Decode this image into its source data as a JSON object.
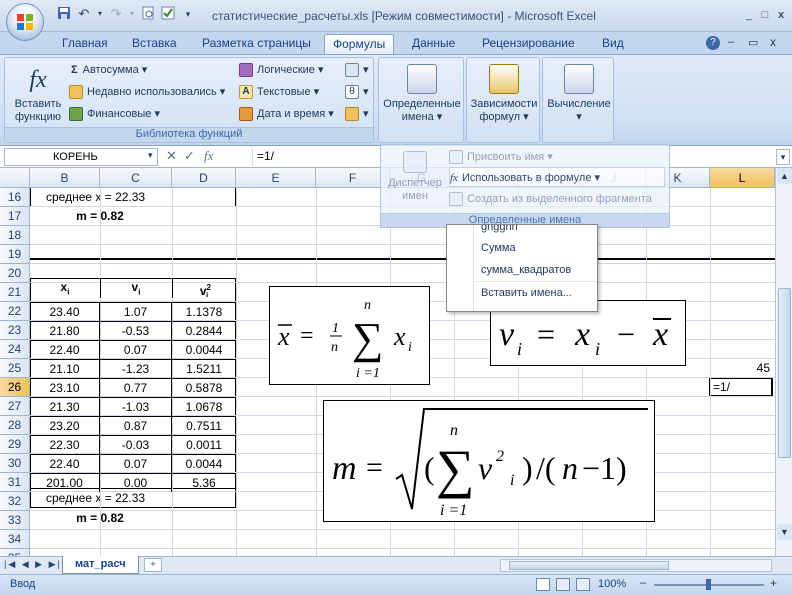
{
  "window": {
    "title": "статистические_расчеты.xls  [Режим совместимости] - Microsoft Excel",
    "controls": [
      "_",
      "□",
      "x"
    ]
  },
  "quick_access": {
    "undo": "↶",
    "redo": "↷"
  },
  "tabs": [
    "Главная",
    "Вставка",
    "Разметка страницы",
    "Формулы",
    "Данные",
    "Рецензирование",
    "Вид"
  ],
  "active_tab": "Формулы",
  "ribbon": {
    "insert_function": {
      "label_line1": "Вставить",
      "label_line2": "функцию",
      "icon": "fx"
    },
    "library": {
      "autosum": "Автосумма",
      "recent": "Недавно использовались",
      "financial": "Финансовые",
      "logical": "Логические",
      "text": "Текстовые",
      "datetime": "Дата и время",
      "label": "Библиотека функций"
    },
    "defined_names": {
      "line1": "Определенные",
      "line2": "имена"
    },
    "dependencies": {
      "line1": "Зависимости",
      "line2": "формул"
    },
    "calculation": {
      "line1": "Вычисление"
    }
  },
  "formula_bar": {
    "name_box": "КОРЕНЬ",
    "fx": "fx",
    "formula": "=1/"
  },
  "dropdown_panel": {
    "name_manager_line1": "Диспетчер",
    "name_manager_line2": "имен",
    "assign_name": "Присвоить имя",
    "use_in_formula": "Использовать в формуле",
    "create_from_selection": "Создать из выделенного фрагмента",
    "group_label": "Определенные имена"
  },
  "popup_menu": {
    "partial": "gnggnn",
    "items": [
      "Сумма",
      "сумма_квадратов",
      "Вставить имена..."
    ]
  },
  "columns": [
    "B",
    "C",
    "D",
    "E",
    "F",
    "G",
    "H",
    "I",
    "J",
    "K",
    "L"
  ],
  "selected_column": "L",
  "rows": [
    "16",
    "17",
    "18",
    "19",
    "20",
    "21",
    "22",
    "23",
    "24",
    "25",
    "26",
    "27",
    "28",
    "29",
    "30",
    "31",
    "32",
    "33",
    "34",
    "35"
  ],
  "selected_row": "26",
  "sheet": {
    "r16_mean": "среднее x = 22.33",
    "r17_m": "m = 0.82",
    "headers": {
      "x": "x",
      "x_sub": "i",
      "v": "v",
      "v_sub": "i",
      "v2": "v",
      "v2_sup": "2",
      "v2_sub": "i"
    },
    "table": [
      [
        "23.40",
        "1.07",
        "1.1378"
      ],
      [
        "21.80",
        "-0.53",
        "0.2844"
      ],
      [
        "22.40",
        "0.07",
        "0.0044"
      ],
      [
        "21.10",
        "-1.23",
        "1.5211"
      ],
      [
        "23.10",
        "0.77",
        "0.5878"
      ],
      [
        "21.30",
        "-1.03",
        "1.0678"
      ],
      [
        "23.20",
        "0.87",
        "0.7511"
      ],
      [
        "22.30",
        "-0.03",
        "0.0011"
      ],
      [
        "22.40",
        "0.07",
        "0.0044"
      ],
      [
        "201.00",
        "0.00",
        "5.36"
      ]
    ],
    "r32_mean": "среднее x = 22.33",
    "r33_m": "m = 0.82",
    "l25_value": "45",
    "l26_edit": "=1/"
  },
  "sheet_tabs": {
    "active": "мат_расч"
  },
  "status": {
    "mode": "Ввод",
    "zoom": "100%"
  }
}
